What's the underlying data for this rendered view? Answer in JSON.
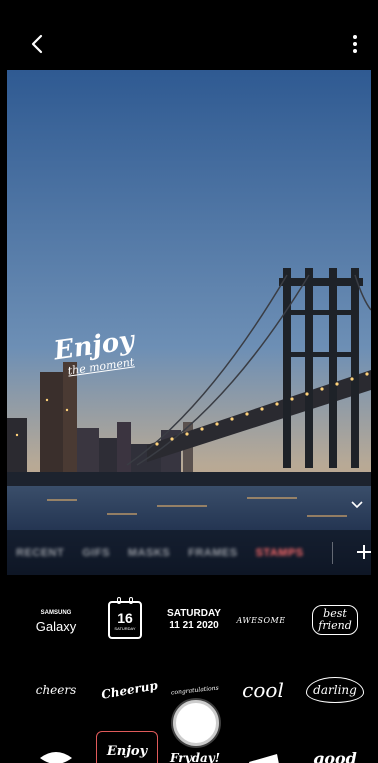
{
  "tabs": [
    {
      "label": "RECENT",
      "active": false
    },
    {
      "label": "GIFS",
      "active": false
    },
    {
      "label": "MASKS",
      "active": false
    },
    {
      "label": "FRAMES",
      "active": false
    },
    {
      "label": "STAMPS",
      "active": true
    }
  ],
  "overlay": {
    "line1": "Enjoy",
    "line2": "the moment"
  },
  "stickers": {
    "samsung": {
      "top": "SAMSUNG",
      "bottom": "Galaxy"
    },
    "calendar": {
      "day": "16",
      "weekday": "SATURDAY"
    },
    "date": {
      "line1": "SATURDAY",
      "line2": "11 21 2020"
    },
    "awesome": "AWESOME",
    "best_friend": {
      "line1": "best",
      "line2": "friend"
    },
    "cheers": "cheers",
    "cheerup": "Cheerup",
    "congratulations": "congratulations",
    "cool": "cool",
    "darling": "darling",
    "enjoy": "Enjoy",
    "fresh": "Fryday!",
    "good": "good"
  },
  "colors": {
    "accent": "#e05a5a",
    "active_tab": "#ff6b6b",
    "background": "#000000"
  }
}
